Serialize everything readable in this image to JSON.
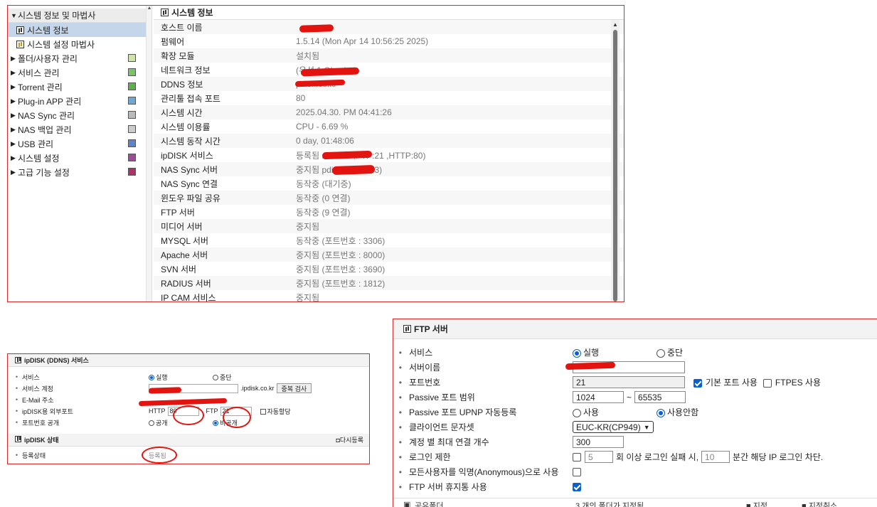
{
  "sidebar": {
    "items": [
      {
        "label": "시스템 정보 및 마법사",
        "expanded": true
      },
      {
        "label": "시스템 정보",
        "selected": true
      },
      {
        "label": "시스템 설정 마법사"
      },
      {
        "label": "폴더/사용자 관리"
      },
      {
        "label": "서비스 관리"
      },
      {
        "label": "Torrent 관리"
      },
      {
        "label": "Plug-in APP 관리"
      },
      {
        "label": "NAS Sync 관리"
      },
      {
        "label": "NAS 백업 관리"
      },
      {
        "label": "USB 관리"
      },
      {
        "label": "시스템 설정"
      },
      {
        "label": "고급 기능 설정"
      }
    ]
  },
  "system_info": {
    "title": "시스템 정보",
    "rows": [
      {
        "key": "호스트 이름",
        "value": ""
      },
      {
        "key": "펌웨어",
        "value": "1.5.14 (Mon Apr 14 10:56:25 2025)"
      },
      {
        "key": "확장 모듈",
        "value": "설치됨"
      },
      {
        "key": "네트워크 정보",
        "value": "(유선 1 Gbps)"
      },
      {
        "key": "DDNS 정보",
        "value": "pdisk.co.kr"
      },
      {
        "key": "관리툴 접속 포트",
        "value": "80"
      },
      {
        "key": "시스템 시간",
        "value": "2025.04.30. PM 04:41:26"
      },
      {
        "key": "시스템 이용률",
        "value": "CPU - 6.69 %"
      },
      {
        "key": "시스템 동작 시간",
        "value": "0 day, 01:48:06"
      },
      {
        "key": "ipDISK 서비스",
        "value": "등록됨 sk.co.kr ,FTP:21 ,HTTP:80)"
      },
      {
        "key": "NAS Sync 서버",
        "value": "중지됨 pdisk.co.kr:873)"
      },
      {
        "key": "NAS Sync 연결",
        "value": "동작중 (대기중)"
      },
      {
        "key": "윈도우 파일 공유",
        "value": "동작중 (0 연결)"
      },
      {
        "key": "FTP 서버",
        "value": "동작중 (9 연결)"
      },
      {
        "key": "미디어 서버",
        "value": "중지됨"
      },
      {
        "key": "MYSQL 서버",
        "value": "동작중 (포트번호 : 3306)"
      },
      {
        "key": "Apache 서버",
        "value": "중지됨 (포트번호 : 8000)"
      },
      {
        "key": "SVN 서버",
        "value": "중지됨 (포트번호 : 3690)"
      },
      {
        "key": "RADIUS 서버",
        "value": "중지됨 (포트번호 : 1812)"
      },
      {
        "key": "IP CAM 서비스",
        "value": "중지됨"
      }
    ]
  },
  "ipdisk": {
    "title": "ipDISK (DDNS) 서비스",
    "service_label": "서비스",
    "run_label": "실행",
    "stop_label": "중단",
    "account_label": "서비스 계정",
    "domain_suffix": ".ipdisk.co.kr",
    "dup_check_label": "중복 검사",
    "email_label": "E-Mail 주소",
    "ext_port_label": "ipDISK용 외부포트",
    "http_label": "HTTP",
    "http_port": "80",
    "ftp_label": "FTP",
    "ftp_port": "21",
    "auto_assign_label": "자동할당",
    "port_public_label": "포트번호 공개",
    "public_label": "공개",
    "private_label": "비공개",
    "status_title": "ipDISK 상태",
    "reregister_label": "다시등록",
    "reg_status_label": "등록상태",
    "reg_status_value": "등록됨"
  },
  "ftp": {
    "title": "FTP 서버",
    "service_label": "서비스",
    "run_label": "실행",
    "stop_label": "중단",
    "server_name_label": "서버이름",
    "port_label": "포트번호",
    "port_value": "21",
    "default_port_label": "기본 포트 사용",
    "ftpes_label": "FTPES 사용",
    "passive_range_label": "Passive 포트 범위",
    "passive_from": "1024",
    "range_sep": "~",
    "passive_to": "65535",
    "upnp_label": "Passive 포트 UPNP 자동등록",
    "use_label": "사용",
    "nouse_label": "사용안함",
    "charset_label": "클라이언트 문자셋",
    "charset_value": "EUC-KR(CP949)",
    "max_conn_label": "계정 별 최대 연결 개수",
    "max_conn_value": "300",
    "login_limit_label": "로그인 제한",
    "login_fail_count": "5",
    "login_text1": "회 이상 로그인 실패 시,",
    "login_block_min": "10",
    "login_text2": "분간 해당 IP 로그인 차단.",
    "anon_label": "모든사용자를 익명(Anonymous)으로 사용",
    "trash_label": "FTP 서버 휴지통 사용",
    "footer_left": "공유폴더",
    "footer_mid": "3 개의 폴더가 지정됨",
    "footer_r1": "■ 지정",
    "footer_r2": "■ 지정취소"
  },
  "colors": {
    "accent": "#0b5fd0",
    "frame": "#d42a2a",
    "redact": "#e3140f"
  }
}
